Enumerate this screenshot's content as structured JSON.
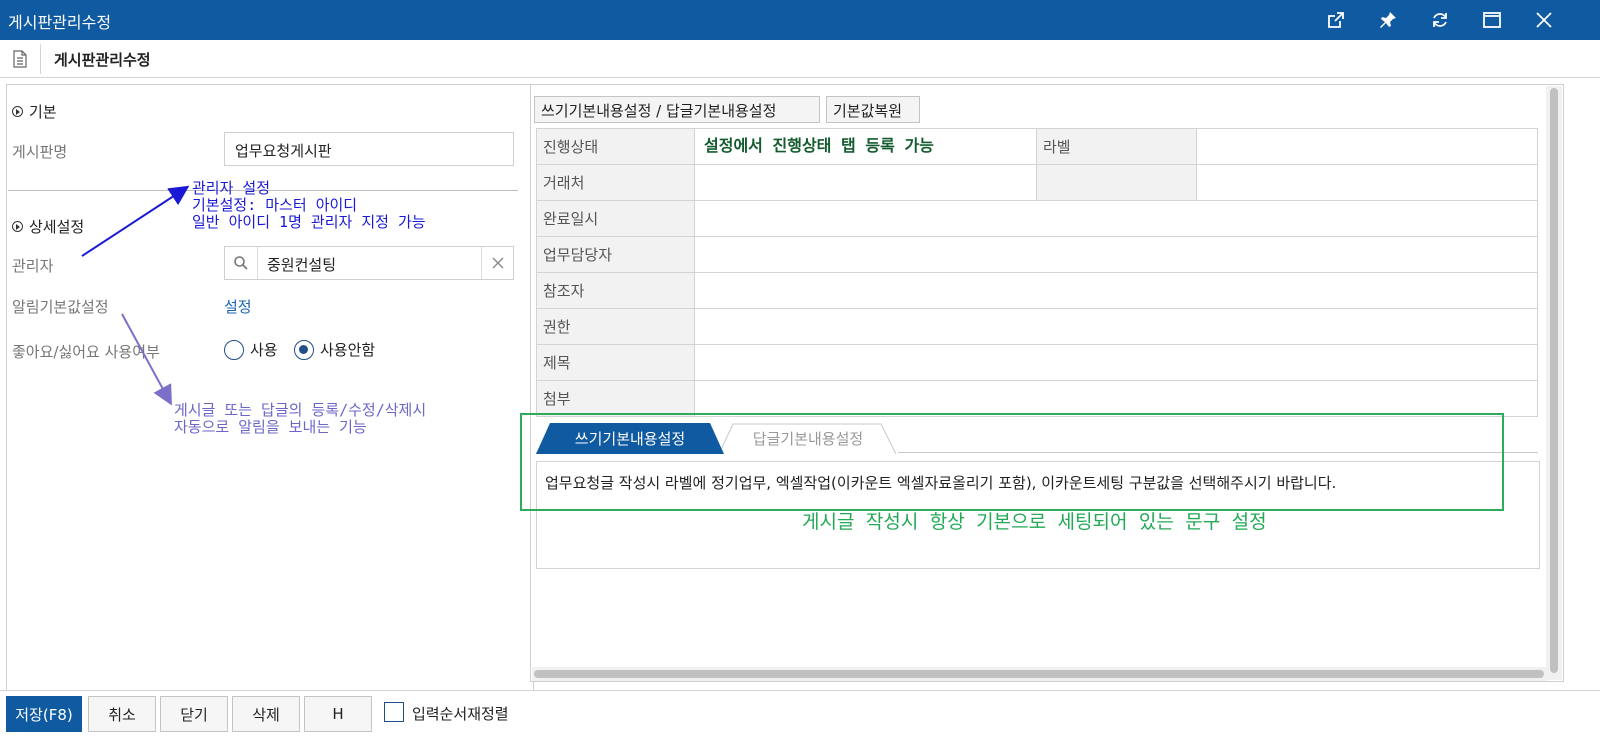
{
  "window": {
    "title": "게시판관리수정"
  },
  "subheader": {
    "title": "게시판관리수정"
  },
  "left": {
    "section_basic": "기본",
    "board_name_label": "게시판명",
    "board_name_value": "업무요청게시판",
    "section_detail": "상세설정",
    "manager_label": "관리자",
    "manager_value": "중원컨설팅",
    "notify_label": "알림기본값설정",
    "notify_link": "설정",
    "like_label": "좋아요/싫어요 사용여부",
    "radio_use": "사용",
    "radio_nouse": "사용안함",
    "radio_selected": "사용안함"
  },
  "annotations": {
    "manager_note": "관리자 설정\n기본설정: 마스터 아이디\n일반 아이디 1명 관리자 지정 가능",
    "notify_note": "게시글 또는 답글의 등록/수정/삭제시\n자동으로 알림을 보내는 기능",
    "status_note": "설정에서 진행상태 탭 등록 가능",
    "default_text_note": "게시글 작성시 항상 기본으로 세팅되어 있는 문구 설정"
  },
  "right": {
    "btn_default_settings": "쓰기기본내용설정 / 답글기본내용설정",
    "btn_restore": "기본값복원",
    "fields": {
      "status": "진행상태",
      "label": "라벨",
      "client": "거래처",
      "completion": "완료일시",
      "assignee": "업무담당자",
      "reference": "참조자",
      "permission": "권한",
      "subject": "제목",
      "attachment": "첨부"
    },
    "tabs": [
      "쓰기기본내용설정",
      "답글기본내용설정"
    ],
    "active_tab": "쓰기기본내용설정",
    "content_text": "업무요청글 작성시 라벨에 정기업무, 엑셀작업(이카운트 엑셀자료올리기 포함), 이카운트세팅  구분값을 선택해주시기 바랍니다."
  },
  "footer": {
    "save": "저장(F8)",
    "cancel": "취소",
    "close": "닫기",
    "delete": "삭제",
    "h": "H",
    "reorder_label": "입력순서재정렬"
  },
  "colors": {
    "titlebar": "#0f5aa0",
    "annotation_blue": "#1a1ad6",
    "annotation_purple": "#6b67c7",
    "annotation_green": "#22aa55",
    "highlight_box": "#2eaa5c"
  },
  "icons": {
    "titlebar": [
      "popout-icon",
      "pin-icon",
      "refresh-icon",
      "maximize-icon",
      "close-icon"
    ],
    "subheader": "document-icon",
    "manager_search": "search-icon",
    "manager_clear": "clear-icon"
  }
}
